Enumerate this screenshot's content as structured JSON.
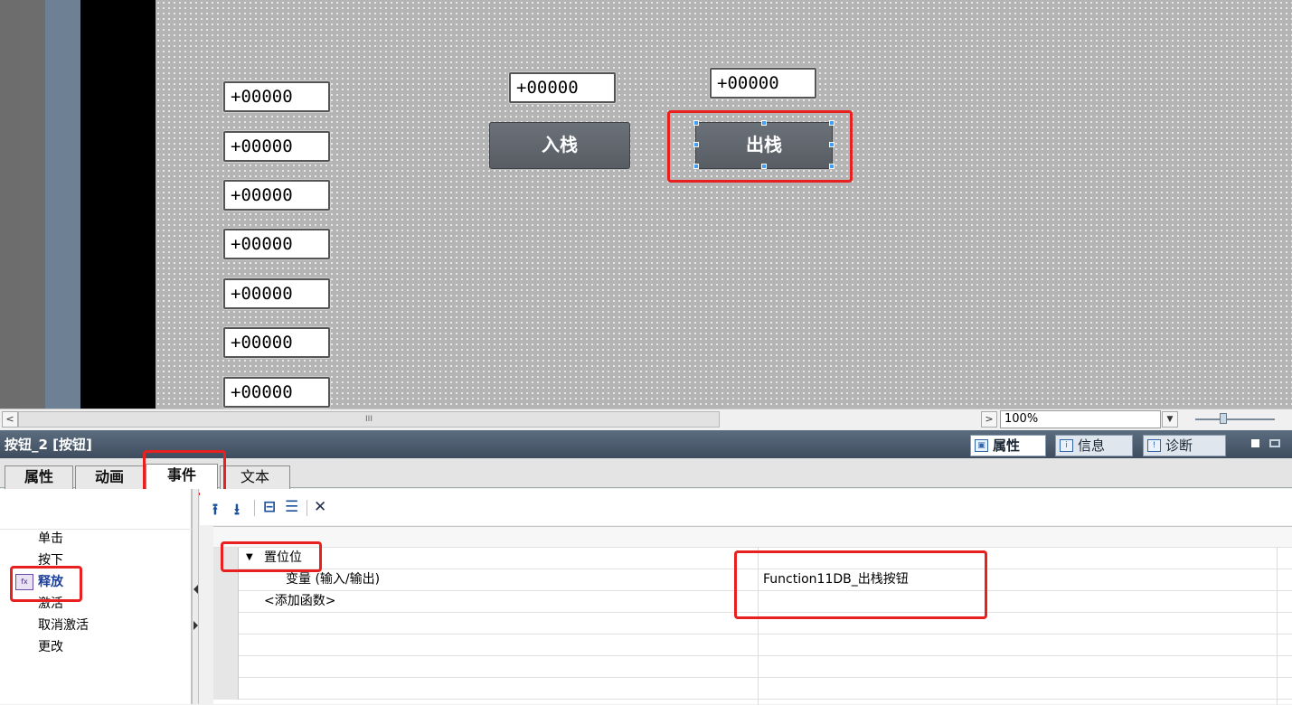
{
  "canvas": {
    "io_fields_left": [
      "+00000",
      "+00000",
      "+00000",
      "+00000",
      "+00000",
      "+00000",
      "+00000"
    ],
    "io_field_middle": "+00000",
    "io_field_right": "+00000",
    "push_button_label": "入栈",
    "pop_button_label": "出栈"
  },
  "scrollbar": {
    "left_arrow": "<",
    "thumb_grip": "III",
    "right_arrow": ">",
    "zoom_value": "100%",
    "dropdown_arrow": "▼"
  },
  "inspector": {
    "title": "按钮_2 [按钮]",
    "tabs": [
      {
        "label": "属性",
        "icon": "properties-icon"
      },
      {
        "label": "信息",
        "icon": "info-icon"
      },
      {
        "label": "诊断",
        "icon": "diagnostics-icon"
      }
    ]
  },
  "property_tabs": [
    "属性",
    "动画",
    "事件",
    "文本"
  ],
  "events": [
    "单击",
    "按下",
    "释放",
    "激活",
    "取消激活",
    "更改"
  ],
  "selected_event": "释放",
  "function_list": {
    "function_name": "置位位",
    "param_name": "变量 (输入/输出)",
    "param_value": "Function11DB_出栈按钮",
    "add_function": "<添加函数>"
  },
  "colors": {
    "highlight_red": "#e82020",
    "canvas_bg": "#b4b4b4",
    "header_bg": "#4c5c6e"
  }
}
